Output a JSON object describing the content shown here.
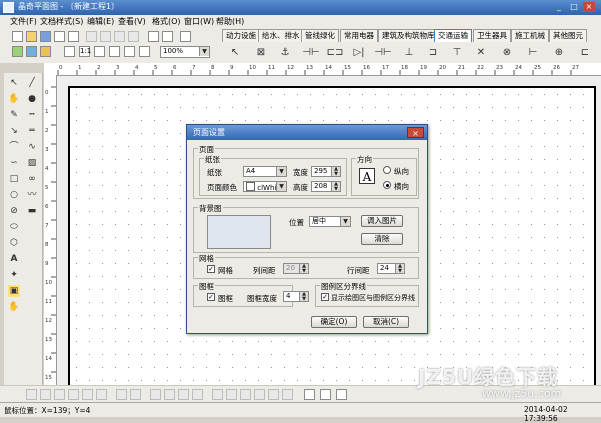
{
  "window": {
    "title": "晶奇平面图 - 〔新建工程1〕",
    "controls": [
      "_",
      "□",
      "×"
    ]
  },
  "menu": [
    "文件(F)",
    "文档样式(S)",
    "编辑(E)",
    "查看(V)",
    "格式(O)",
    "窗口(W)",
    "帮助(H)"
  ],
  "toolbar": {
    "zoom_value": "100%"
  },
  "symbol_tabs": [
    "动力设施",
    "给水、排水",
    "管线绿化",
    "常用电器",
    "建筑及构筑物库",
    "交通运输",
    "卫生器具",
    "施工机械",
    "其他图元"
  ],
  "active_tab_index": 5,
  "ruler": {
    "h_ticks": [
      "0",
      "1",
      "2",
      "3",
      "4",
      "5",
      "6",
      "7",
      "8",
      "9",
      "10",
      "11",
      "12",
      "13",
      "14",
      "15",
      "16",
      "17",
      "18",
      "19",
      "20",
      "21",
      "22",
      "23",
      "24",
      "25",
      "26",
      "27"
    ],
    "v_ticks": [
      "0",
      "1",
      "2",
      "3",
      "4",
      "5",
      "6",
      "7",
      "8",
      "9",
      "10",
      "11",
      "12",
      "13",
      "14",
      "15"
    ]
  },
  "dialog": {
    "title": "页面设置",
    "close": "×",
    "page_group": "页面",
    "paper_group": "纸张",
    "paper_label": "纸张",
    "paper_value": "A4",
    "width_label": "宽度",
    "width_value": "295",
    "color_label": "页面颜色",
    "color_value": "clWhit",
    "height_label": "高度",
    "height_value": "208",
    "orientation_group": "方向",
    "orientation_icon": "A",
    "portrait_label": "纵向",
    "landscape_label": "横向",
    "landscape_selected": true,
    "background_group": "背景图",
    "position_label": "位置",
    "position_value": "居中",
    "import_button": "调入图片",
    "clear_button": "清除",
    "grid_group": "网格",
    "grid_checkbox": "网格",
    "col_spacing_label": "列间距",
    "col_spacing_value": "20",
    "row_spacing_label": "行间距",
    "row_spacing_value": "24",
    "frame_group": "图框",
    "frame_checkbox": "图框",
    "frame_width_label": "图框宽度",
    "frame_width_value": "4",
    "legend_group": "图例区分界线",
    "legend_checkbox": "显示绘图区与图例区分界线",
    "ok_button": "确定(O)",
    "cancel_button": "取消(C)"
  },
  "status": {
    "mouse_pos": "鼠标位置：X=139；Y=4",
    "datetime": "2014-04-02  17:39:56"
  },
  "watermark": {
    "main": "JZ5U绿色下载",
    "url": "www.jz5u.com"
  }
}
